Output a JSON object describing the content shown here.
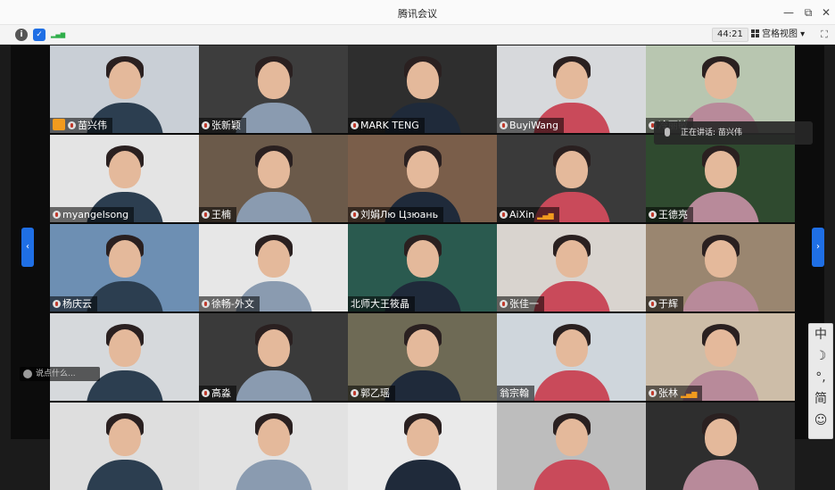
{
  "window": {
    "title": "腾讯会议",
    "minimize_icon": "—",
    "restore_icon": "⧉",
    "close_icon": "✕"
  },
  "toolbar": {
    "info_icon": "i",
    "shield_icon": "✓",
    "signal_icon": "▂▄▆",
    "timer": "44:21",
    "view_label": "宫格视图 ▾",
    "fullscreen_icon": "⛶"
  },
  "speaking_indicator": {
    "text": "正在讲话: 苗兴伟"
  },
  "floating_control": {
    "text": "说点什么..."
  },
  "ime_bar": {
    "chars": [
      "中",
      "☽",
      "°,",
      "简",
      "☺"
    ]
  },
  "nav": {
    "prev": "‹",
    "next": "›"
  },
  "participants": [
    {
      "name": "苗兴伟",
      "host": true,
      "mic_muted": false,
      "signal": false
    },
    {
      "name": "张新颖",
      "host": false,
      "mic_muted": true,
      "signal": false
    },
    {
      "name": "MARK TENG",
      "host": false,
      "mic_muted": true,
      "signal": false
    },
    {
      "name": "BuyiWang",
      "host": false,
      "mic_muted": true,
      "signal": false
    },
    {
      "name": "冷丽敏",
      "host": false,
      "mic_muted": true,
      "signal": false
    },
    {
      "name": "myangelsong",
      "host": false,
      "mic_muted": true,
      "signal": false
    },
    {
      "name": "王楠",
      "host": false,
      "mic_muted": true,
      "signal": false
    },
    {
      "name": "刘娟Лю Цзюань",
      "host": false,
      "mic_muted": true,
      "signal": false
    },
    {
      "name": "AiXin",
      "host": false,
      "mic_muted": true,
      "signal": true
    },
    {
      "name": "王德亮",
      "host": false,
      "mic_muted": true,
      "signal": false
    },
    {
      "name": "杨庆云",
      "host": false,
      "mic_muted": true,
      "signal": false
    },
    {
      "name": "徐畅-外文",
      "host": false,
      "mic_muted": true,
      "signal": false
    },
    {
      "name": "北师大王筱晶",
      "host": false,
      "mic_muted": false,
      "signal": false
    },
    {
      "name": "张佳一",
      "host": false,
      "mic_muted": true,
      "signal": false
    },
    {
      "name": "于辉",
      "host": false,
      "mic_muted": true,
      "signal": false
    },
    {
      "name": "",
      "host": false,
      "mic_muted": false,
      "signal": false
    },
    {
      "name": "高淼",
      "host": false,
      "mic_muted": true,
      "signal": false
    },
    {
      "name": "郭乙瑶",
      "host": false,
      "mic_muted": true,
      "signal": false
    },
    {
      "name": "翁宗翰",
      "host": false,
      "mic_muted": false,
      "signal": false
    },
    {
      "name": "张林",
      "host": false,
      "mic_muted": true,
      "signal": true
    },
    {
      "name": "",
      "host": false,
      "mic_muted": false,
      "signal": false
    },
    {
      "name": "",
      "host": false,
      "mic_muted": false,
      "signal": false
    },
    {
      "name": "",
      "host": false,
      "mic_muted": false,
      "signal": false
    },
    {
      "name": "",
      "host": false,
      "mic_muted": false,
      "signal": false
    },
    {
      "name": "",
      "host": false,
      "mic_muted": false,
      "signal": false
    }
  ]
}
